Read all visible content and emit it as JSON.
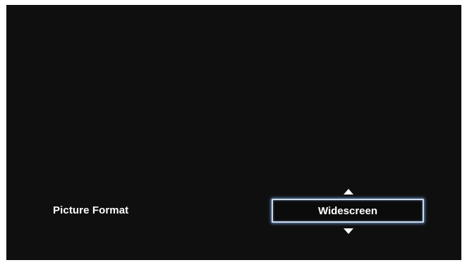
{
  "setting": {
    "label": "Picture Format",
    "value": "Widescreen"
  },
  "icons": {
    "up": "arrow-up-icon",
    "down": "arrow-down-icon"
  },
  "colors": {
    "background": "#0f0f0f",
    "text": "#ffffff",
    "focus_highlight": "#78aae6"
  }
}
